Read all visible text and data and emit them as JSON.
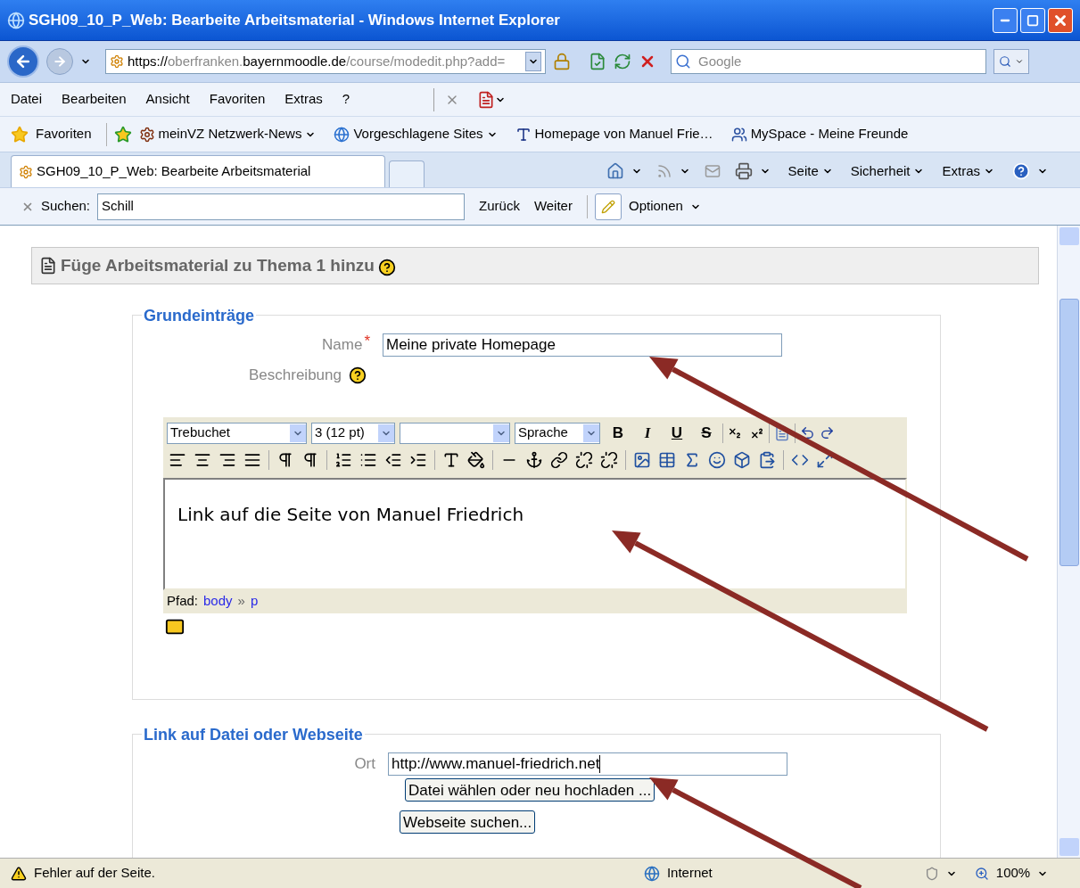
{
  "window": {
    "title": "SGH09_10_P_Web: Bearbeite Arbeitsmaterial - Windows Internet Explorer"
  },
  "address_bar": {
    "parts": [
      {
        "text": "https://",
        "strong": true
      },
      {
        "text": "oberfranken.",
        "strong": false
      },
      {
        "text": "bayernmoodle.de",
        "strong": true
      },
      {
        "text": "/course/modedit.php?add=",
        "strong": false
      }
    ]
  },
  "search_box": {
    "placeholder": "Google"
  },
  "menu": [
    "Datei",
    "Bearbeiten",
    "Ansicht",
    "Favoriten",
    "Extras",
    "?"
  ],
  "favorites_bar": {
    "label": "Favoriten",
    "links": [
      {
        "label": "meinVZ Netzwerk-News",
        "dropdown": true
      },
      {
        "label": "Vorgeschlagene Sites",
        "dropdown": true
      },
      {
        "label": "Homepage von Manuel Frie…",
        "dropdown": false
      },
      {
        "label": "MySpace - Meine Freunde",
        "dropdown": false
      }
    ]
  },
  "tabs": [
    {
      "label": "SGH09_10_P_Web: Bearbeite Arbeitsmaterial",
      "selected": true
    }
  ],
  "command_bar": [
    "Seite",
    "Sicherheit",
    "Extras"
  ],
  "find_bar": {
    "label": "Suchen:",
    "value": "Schill",
    "buttons": [
      "Zurück",
      "Weiter"
    ],
    "options": "Optionen"
  },
  "page": {
    "heading": "Füge Arbeitsmaterial zu Thema 1 hinzu",
    "section_1": {
      "legend": "Grundeinträge",
      "name_label": "Name",
      "required_mark": "*",
      "name_value": "Meine private Homepage",
      "description_label": "Beschreibung",
      "editor": {
        "selects": [
          {
            "value": "Trebuchet"
          },
          {
            "value": "3 (12 pt)"
          },
          {
            "value": "Sprache"
          }
        ],
        "format_buttons": [
          {
            "label": "B",
            "kind": "bold"
          },
          {
            "label": "I",
            "kind": "italic"
          },
          {
            "label": "U",
            "kind": "underline"
          },
          {
            "label": "S",
            "kind": "strike"
          }
        ],
        "content": "Link auf die Seite von Manuel Friedrich",
        "path_label": "Pfad:",
        "path": [
          "body",
          "p"
        ],
        "separator": "»"
      }
    },
    "section_2": {
      "legend": "Link auf Datei oder Webseite",
      "location_label": "Ort",
      "location_value": "http://www.manuel-friedrich.net",
      "buttons": [
        "Datei wählen oder neu hochladen ...",
        "Webseite suchen..."
      ]
    }
  },
  "status_bar": {
    "text": "Fehler auf der Seite.",
    "zone": "Internet",
    "zoom": "100%"
  }
}
